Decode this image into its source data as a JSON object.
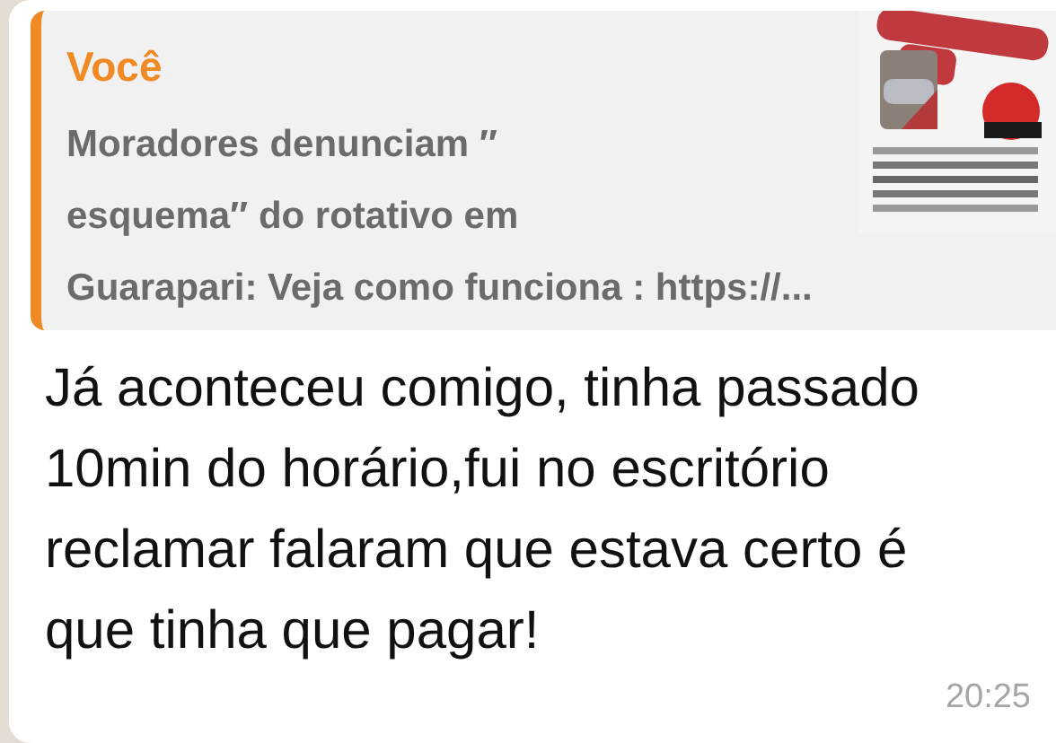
{
  "quote": {
    "author": "Você",
    "lines": [
      "Moradores denunciam ″",
      "esquema″ do rotativo em",
      "Guarapari: Veja como funciona : https://..."
    ]
  },
  "message": {
    "text": "Já aconteceu comigo, tinha passado 10min do horário,fui no escritório reclamar falaram que estava certo é que tinha que pagar!",
    "time": "20:25"
  }
}
